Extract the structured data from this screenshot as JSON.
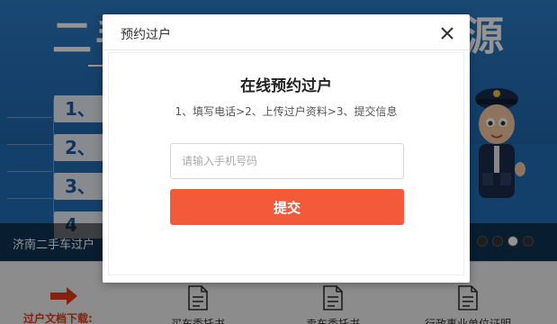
{
  "banner": {
    "title_left": "二手",
    "title_right": "源",
    "steps": [
      "1、",
      "2、",
      "3、",
      "4"
    ],
    "caption": "济南二手车过户",
    "slides": 4,
    "active_slide": 3
  },
  "downloads": {
    "label": "过户文档下载:",
    "docs": [
      {
        "label": "买车委托书",
        "icon": "document-icon"
      },
      {
        "label": "卖车委托书",
        "icon": "document-icon"
      },
      {
        "label": "行政事业单位证明",
        "icon": "document-icon"
      }
    ]
  },
  "modal": {
    "title": "预约过户",
    "close_icon": "close-icon",
    "heading": "在线预约过户",
    "steps_text": "1、填写电话>2、上传过户资料>3、提交信息",
    "phone_placeholder": "请输入手机号码",
    "phone_value": "",
    "submit_label": "提交"
  },
  "colors": {
    "accent": "#f35a3a",
    "banner_blue": "#1f6fb8",
    "download_label": "#e03c1a"
  }
}
